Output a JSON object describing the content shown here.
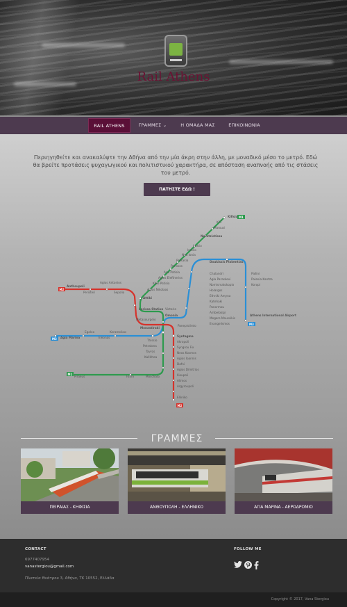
{
  "brand": {
    "title": "Rail Athens",
    "logo": "metro-train-logo"
  },
  "nav": {
    "items": [
      {
        "label": "RAIL ATHENS",
        "active": true
      },
      {
        "label": "ΓΡΑΜΜΕΣ ⌄",
        "active": false
      },
      {
        "label": "Η ΟΜΑΔΑ ΜΑΣ",
        "active": false
      },
      {
        "label": "ΕΠΙΚΟΙΝΩΝΙΑ",
        "active": false
      }
    ]
  },
  "intro": {
    "text": "Περιηγηθείτε και ανακαλύψτε την Αθήνα από την μία άκρη στην άλλη, με μοναδικό μέσο το μετρό. Εδώ θα βρείτε προτάσεις ψυχαγωγικού και πολιτιστικού χαρακτήρα, σε απόσταση αναπνοής από τις στάσεις του μετρό.",
    "cta": "ΠΑΤΗΣΤΕ ΕΔΩ !"
  },
  "map": {
    "colors": {
      "m1": "#2e9a4e",
      "m2": "#d6322b",
      "m3": "#2a8fd6"
    },
    "badges": {
      "m1": "M1",
      "m2": "M2",
      "m3": "M3"
    },
    "terminals": {
      "kifisia": "Kifisia",
      "anthoupoli": "Anthoupoli",
      "agia_marina": "Agia Marina",
      "airport": "Athens International Airport",
      "elliniko": "Elliniko",
      "piraeus": "Piraeus"
    },
    "stations": {
      "kat": "KAT",
      "marousi": "Marousi",
      "neratziotissa": "Neratziotissa",
      "iraklio": "Iraklio",
      "nea_ionia": "Nea Ionia",
      "pefkakia": "Pefkakia",
      "perissos": "Perissos",
      "ano_patisia": "Ano Patisia",
      "agios_eleftherios": "Agios Eleftherios",
      "kato_patisia": "Kato Patisia",
      "agios_nikolaos": "Agios Nikolaos",
      "attiki": "Attiki",
      "larissa": "Larissa Station",
      "metaxourgeio": "Metaxourgeio",
      "omonia": "Omonia",
      "victoria": "Victoria",
      "monastiraki": "Monastiraki",
      "panepistimio": "Panepistimio",
      "syntagma": "Syntagma",
      "akropoli": "Akropoli",
      "syngrou_fix": "Syngrou Fix",
      "neos_kosmos": "Neos Kosmos",
      "agios_ioannis": "Agios Ioannis",
      "dafni": "Dafni",
      "agios_dimitrios": "Agios Dimitrios",
      "ilioupoli": "Ilioupoli",
      "alimos": "Alimos",
      "argyroupoli": "Argyroupoli",
      "thissio": "Thissio",
      "petralona": "Petralona",
      "tavros": "Tavros",
      "kallithea": "Kallithea",
      "faliro": "Faliro",
      "moschato": "Moschato",
      "peristeri": "Peristeri",
      "agios_antonios": "Agios Antonios",
      "sepolia": "Sepolia",
      "egaleo": "Egaleo",
      "eleonas": "Eleonas",
      "kerameikos": "Kerameikos",
      "doukissis": "Doukissis Plakentias",
      "chalandri": "Chalandri",
      "agia_paraskevi": "Agia Paraskevi",
      "nomismatokopio": "Nomismatokopio",
      "holargos": "Holargos",
      "ethniki_amyna": "Ethniki Amyna",
      "katehaki": "Katehaki",
      "panormou": "Panormou",
      "ambelokipi": "Ambelokipi",
      "megaro": "Megaro Moussikis",
      "evangelismos": "Evangelismos",
      "pallini": "Pallini",
      "paiania": "Paiania Kantza",
      "koropi": "Koropi"
    }
  },
  "lines_section": {
    "title": "ΓΡΑΜΜΕΣ",
    "cards": [
      {
        "caption": "ΠΕΙΡΑΙΑΣ - ΚΗΦΙΣΙΑ",
        "photo": "m1-train-photo"
      },
      {
        "caption": "ΑΝΘΟΥΠΟΛΗ - ΕΛΛΗΝΙΚΟ",
        "photo": "m2-train-photo"
      },
      {
        "caption": "ΑΓΙΑ ΜΑΡΙΝΑ - ΑΕΡΟΔΡΟΜΙΟ",
        "photo": "m3-train-photo"
      }
    ]
  },
  "footer": {
    "contact_heading": "CONTACT",
    "phone": "6977407954",
    "email": "vanastergiou@gmail.com",
    "address": "Πλατεία Θεάτρου 3, Αθήνα, ΤΚ 10552, Ελλάδα",
    "follow_heading": "FOLLOW ME",
    "social": [
      "twitter-icon",
      "pinterest-icon",
      "facebook-icon"
    ],
    "copyright": "Copyright © 2017, Vana Stergiou"
  }
}
